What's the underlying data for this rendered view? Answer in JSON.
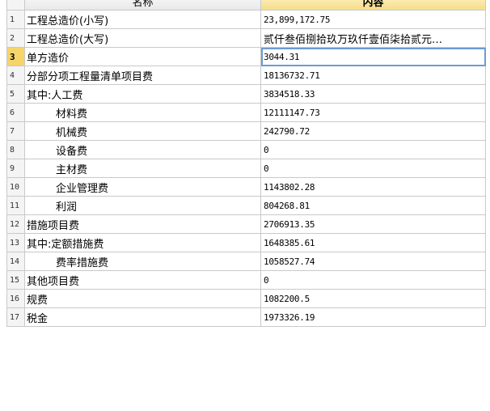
{
  "header": {
    "name_label": "名称",
    "value_label": "内容"
  },
  "rows": [
    {
      "no": "1",
      "name": "工程总造价(小写)",
      "value": "23,899,172.75",
      "indent": false
    },
    {
      "no": "2",
      "name": "工程总造价(大写)",
      "value": "贰仟叁佰捌拾玖万玖仟壹佰柒拾贰元…",
      "indent": false,
      "wide": true
    },
    {
      "no": "3",
      "name": "单方造价",
      "value": "3044.31",
      "indent": false,
      "selected": true
    },
    {
      "no": "4",
      "name": "分部分项工程量清单项目费",
      "value": "18136732.71",
      "indent": false
    },
    {
      "no": "5",
      "name": "其中:人工费",
      "value": "3834518.33",
      "indent": false
    },
    {
      "no": "6",
      "name": "材料费",
      "value": "12111147.73",
      "indent": true
    },
    {
      "no": "7",
      "name": "机械费",
      "value": "242790.72",
      "indent": true
    },
    {
      "no": "8",
      "name": "设备费",
      "value": "0",
      "indent": true
    },
    {
      "no": "9",
      "name": "主材费",
      "value": "0",
      "indent": true
    },
    {
      "no": "10",
      "name": "企业管理费",
      "value": "1143802.28",
      "indent": true
    },
    {
      "no": "11",
      "name": "利润",
      "value": "804268.81",
      "indent": true
    },
    {
      "no": "12",
      "name": "措施项目费",
      "value": "2706913.35",
      "indent": false
    },
    {
      "no": "13",
      "name": "其中:定额措施费",
      "value": "1648385.61",
      "indent": false
    },
    {
      "no": "14",
      "name": "费率措施费",
      "value": "1058527.74",
      "indent": true
    },
    {
      "no": "15",
      "name": "其他项目费",
      "value": "0",
      "indent": false
    },
    {
      "no": "16",
      "name": "规费",
      "value": "1082200.5",
      "indent": false
    },
    {
      "no": "17",
      "name": "税金",
      "value": "1973326.19",
      "indent": false
    }
  ]
}
